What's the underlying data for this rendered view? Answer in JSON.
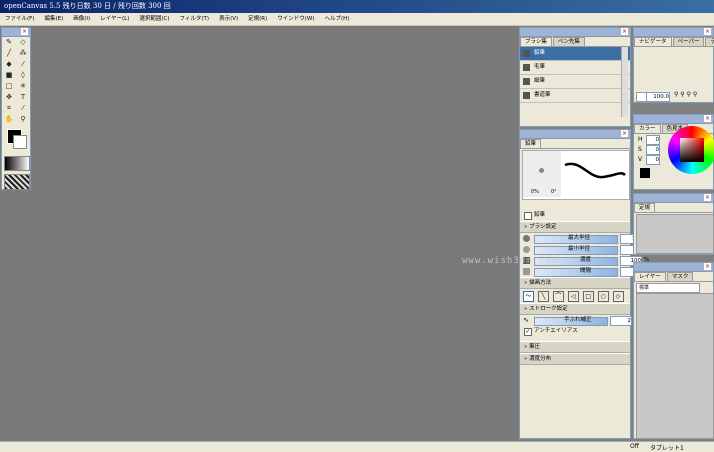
{
  "window": {
    "title": "openCanvas 5.5  残り日数 30 日 / 残り回数 300 回"
  },
  "menu": [
    "ファイル(F)",
    "編集(E)",
    "画像(I)",
    "レイヤー(L)",
    "選択範囲(C)",
    "フィルタ(T)",
    "表示(V)",
    "定規(R)",
    "ウインドウ(W)",
    "ヘルプ(H)"
  ],
  "brush_panel": {
    "tabs": [
      "ブラシ集",
      "ペン先集"
    ],
    "items": [
      "鉛筆",
      "毛筆",
      "細筆",
      "書道筆"
    ],
    "selected": 0
  },
  "brush_settings": {
    "title": "鉛筆",
    "preview_labels": [
      "0%",
      "0°"
    ],
    "checkbox": "鉛筆",
    "section_brush": "ブラシ設定",
    "rows": [
      {
        "label": "最大半径",
        "value": "5.0",
        "unit": "px"
      },
      {
        "label": "最小半径",
        "value": "0",
        "unit": "%"
      },
      {
        "label": "濃度",
        "value": "100",
        "unit": "%"
      },
      {
        "label": "間隔",
        "value": "10",
        "unit": "%"
      }
    ],
    "section_draw": "描画方法",
    "section_stroke": "ストローク設定",
    "stroke_row": {
      "label": "手ぶれ補正",
      "value": "2"
    },
    "antialias": "アンチエイリアス",
    "section_pressure": "筆圧",
    "section_density": "濃度分布"
  },
  "navigator": {
    "tabs": [
      "ナビゲータ",
      "ペーパー",
      "テクスチャ"
    ],
    "zoom": "100.0"
  },
  "color_panel": {
    "tabs": [
      "カラー",
      "色見本"
    ],
    "h": "0",
    "s": "0",
    "v": "0"
  },
  "ruler_panel": {
    "tabs": [
      "定規"
    ]
  },
  "layer_panel": {
    "tabs": [
      "レイヤー",
      "マスク"
    ],
    "mode": "標準"
  },
  "watermark": "www.wish3dm.com",
  "status": {
    "left": "Off",
    "right": "タブレット1"
  },
  "colors": {
    "accent": "#3a6ea5",
    "panel": "#ece9d8",
    "canvas": "#7a7a7a"
  }
}
